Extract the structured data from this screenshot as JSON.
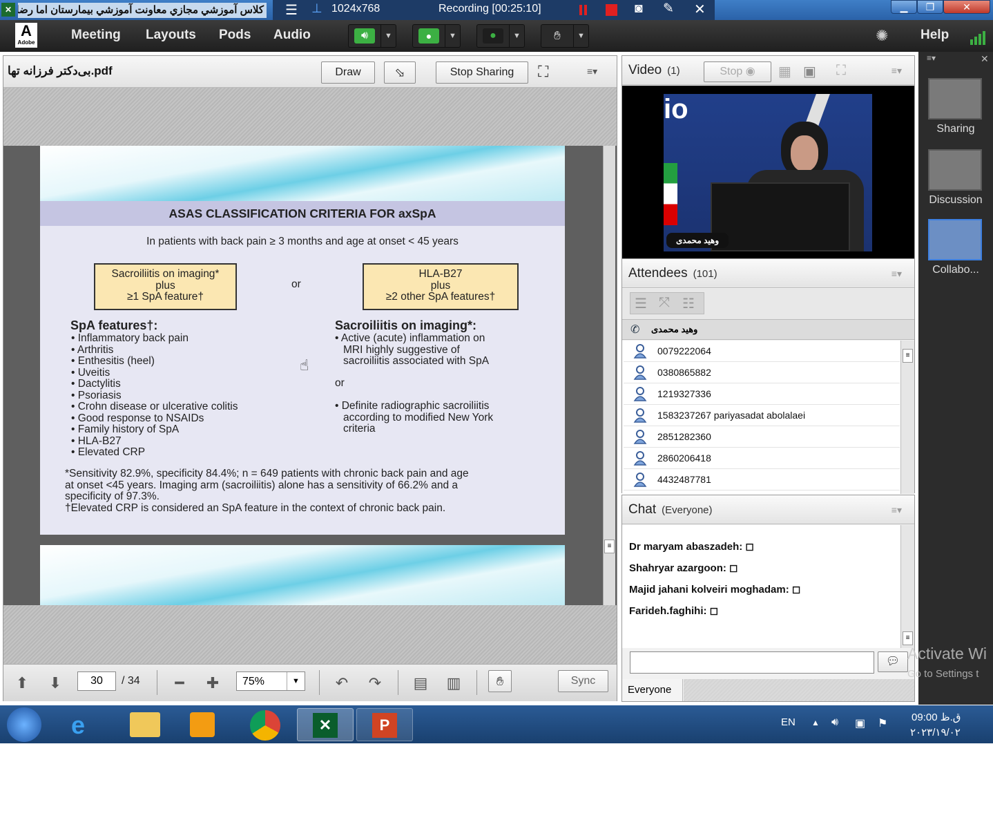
{
  "window": {
    "title": "كلاس آموزشي مجازي معاونت آموزشي بيمارستان اما رضا (Co",
    "resolution": "1024x768",
    "recording": "Recording [00:25:10]"
  },
  "menubar": {
    "logo": "Adobe",
    "items": [
      "Meeting",
      "Layouts",
      "Pods",
      "Audio"
    ],
    "help": "Help"
  },
  "share": {
    "filename": "بی‌دکتر فرزانه تها.pdf",
    "draw_label": "Draw",
    "stop_sharing_label": "Stop Sharing",
    "page": "30",
    "total_pages": "/ 34",
    "zoom": "75%",
    "sync_label": "Sync"
  },
  "slide": {
    "title": "ASAS CLASSIFICATION CRITERIA FOR axSpA",
    "subtitle": "In patients with back pain ≥ 3 months and age at onset < 45 years",
    "box_left": [
      "Sacroiliitis on imaging*",
      "plus",
      "≥1 SpA feature†"
    ],
    "or1": "or",
    "box_right": [
      "HLA-B27",
      "plus",
      "≥2 other SpA features†"
    ],
    "spa_heading": "SpA features†:",
    "spa_features": [
      "Inflammatory back pain",
      "Arthritis",
      "Enthesitis (heel)",
      "Uveitis",
      "Dactylitis",
      "Psoriasis",
      "Crohn disease or ulcerative colitis",
      "Good response to NSAIDs",
      "Family history of SpA",
      "HLA-B27",
      "Elevated CRP"
    ],
    "sacro_heading": "Sacroiliitis on imaging*:",
    "sacro_item1": [
      "Active (acute) inflammation on",
      "MRI highly suggestive of",
      "sacroiliitis associated with SpA"
    ],
    "or2": "or",
    "sacro_item2": [
      "Definite radiographic sacroiliitis",
      "according to modified New York",
      "criteria"
    ],
    "footnotes": [
      "*Sensitivity 82.9%, specificity 84.4%; n = 649 patients with chronic back pain and age",
      "at onset <45 years. Imaging arm (sacroiliitis) alone has a sensitivity of 66.2% and a",
      "specificity of 97.3%.",
      "†Elevated CRP is considered an SpA feature in the context of chronic back pain."
    ]
  },
  "video": {
    "title": "Video",
    "count": "(1)",
    "stop_label": "Stop",
    "caption": "وهید محمدی",
    "screen_text": "io"
  },
  "attendees": {
    "title": "Attendees",
    "count": "(101)",
    "host": "وهید محمدی",
    "list": [
      "0079222064",
      "0380865882",
      "1219327336",
      "1583237267 pariyasadat abolalaei",
      "2851282360",
      "2860206418",
      "4432487781"
    ]
  },
  "chat": {
    "title": "Chat",
    "scope": "(Everyone)",
    "messages": [
      "Dr maryam abaszadeh: ◻",
      "Shahryar azargoon: ◻",
      "Majid jahani kolveiri moghadam: ◻",
      "Farideh.faghihi: ◻"
    ],
    "tab_everyone": "Everyone"
  },
  "layouts": [
    "Sharing",
    "Discussion",
    "Collabo..."
  ],
  "watermark": {
    "line1": "Activate Wi",
    "line2": "Go to Settings t"
  },
  "taskbar": {
    "lang": "EN",
    "time": "09:00 ق.ظ",
    "date": "۲۰۲۳/۱۹/۰۲"
  },
  "colors": {
    "accent": "#2a62a8",
    "menubar": "#2a2a2a",
    "mic_green": "#3cb043",
    "record_red": "#e02020"
  }
}
